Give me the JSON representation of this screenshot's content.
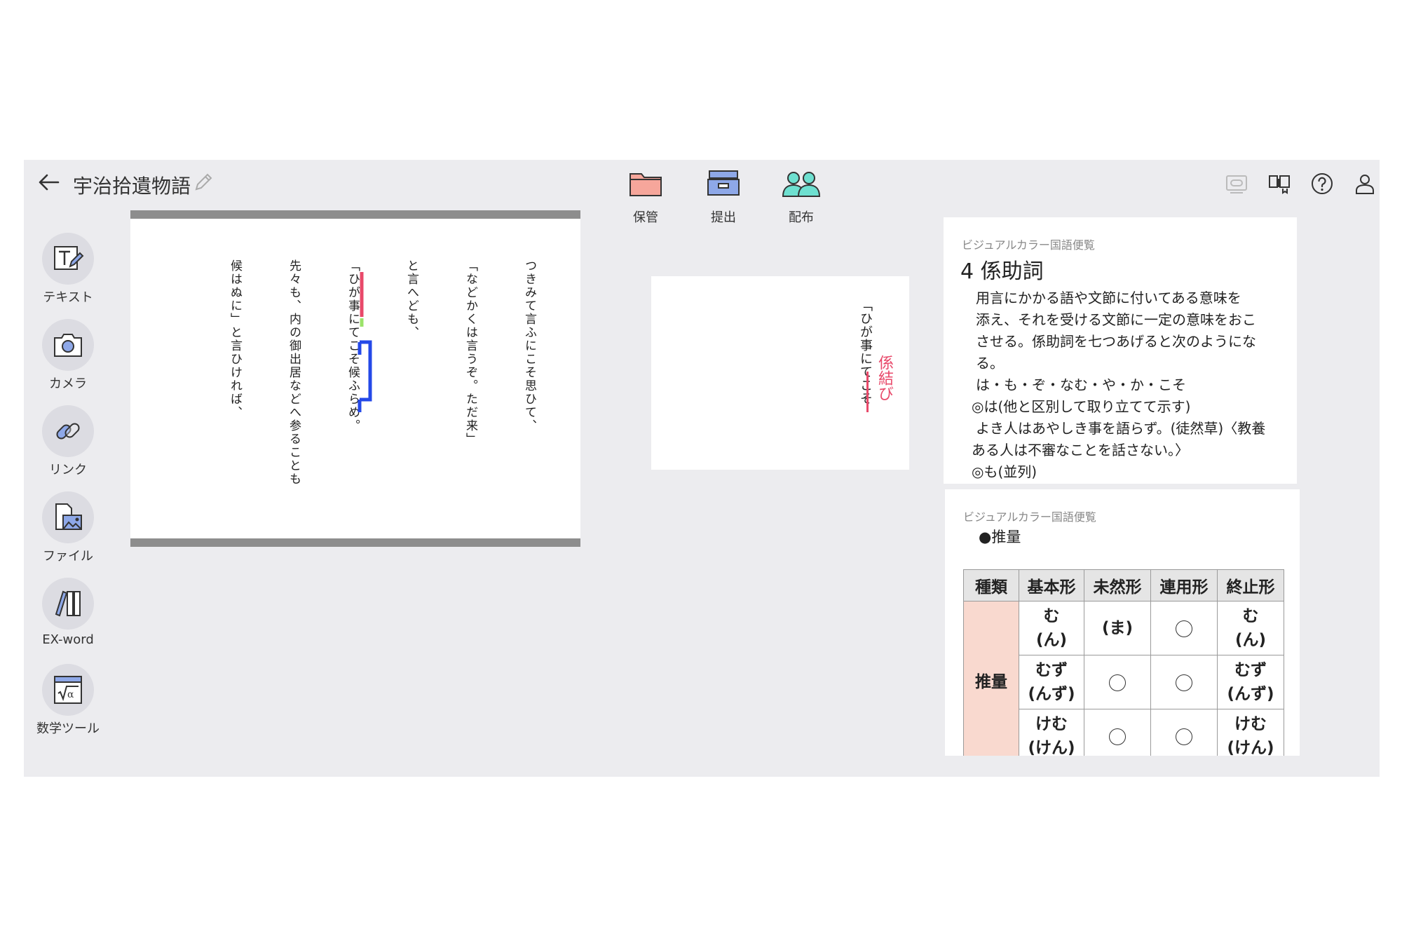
{
  "header": {
    "title": "宇治拾遺物語",
    "back_icon": "arrow-left-icon",
    "right_icons": [
      "caption-icon",
      "book-open-icon",
      "help-icon",
      "user-icon"
    ]
  },
  "toolbar": [
    {
      "label": "保管",
      "icon": "folder-icon"
    },
    {
      "label": "提出",
      "icon": "inbox-tray-icon"
    },
    {
      "label": "配布",
      "icon": "users-icon"
    }
  ],
  "sidebar": [
    {
      "label": "テキスト",
      "icon": "text-edit-icon"
    },
    {
      "label": "カメラ",
      "icon": "camera-icon"
    },
    {
      "label": "リンク",
      "icon": "link-icon"
    },
    {
      "label": "ファイル",
      "icon": "file-image-icon"
    },
    {
      "label": "EX-word",
      "icon": "dictionary-icon"
    },
    {
      "label": "数学ツール",
      "icon": "math-tool-icon"
    }
  ],
  "document": {
    "lines": [
      "つきみて言ふにこそ思ひて、",
      "「などかくは言うぞ。ただ来」",
      "と言へども、",
      "「ひが事にてこそ候ふらめ。",
      "先々も、内の御出居などへ参ることも",
      "候はぬに」と言ひければ、"
    ],
    "highlight_colors": {
      "red": "#e8496a",
      "green": "#9be36a",
      "blue": "#2449e8"
    }
  },
  "note": {
    "text": "「ひが事にてこそ",
    "annotation": "係結び",
    "annotation_color": "#e8496a"
  },
  "ref1": {
    "source": "ビジュアルカラー国語便覧",
    "heading": "4 係助詞",
    "lines": [
      " 用言にかかる語や文節に付いてある意味を",
      "添え、それを受ける文節に一定の意味をおこ",
      "させる。係助詞を七つあげると次のようにな",
      "る。",
      " は・も・ぞ・なむ・や・か・こそ",
      "◎は(他と区別して取り立てて示す)",
      " よき人はあやしき事を語らず。(徒然草)〈教養",
      "ある人は不審なことを話さない。〉",
      "◎も(並列)"
    ]
  },
  "ref2": {
    "source": "ビジュアルカラー国語便覧",
    "subtitle": "●推量",
    "table": {
      "headers": [
        "種類",
        "基本形",
        "未然形",
        "連用形",
        "終止形"
      ],
      "kind": "推量",
      "rows": [
        {
          "base": "む\n(ん)",
          "mizen": "(ま)",
          "renyou": "○",
          "shushi": "む\n(ん)"
        },
        {
          "base": "むず\n(んず)",
          "mizen": "○",
          "renyou": "○",
          "shushi": "むず\n(んず)"
        },
        {
          "base": "けむ\n(けん)",
          "mizen": "○",
          "renyou": "○",
          "shushi": "けむ\n(けん)"
        }
      ]
    }
  }
}
